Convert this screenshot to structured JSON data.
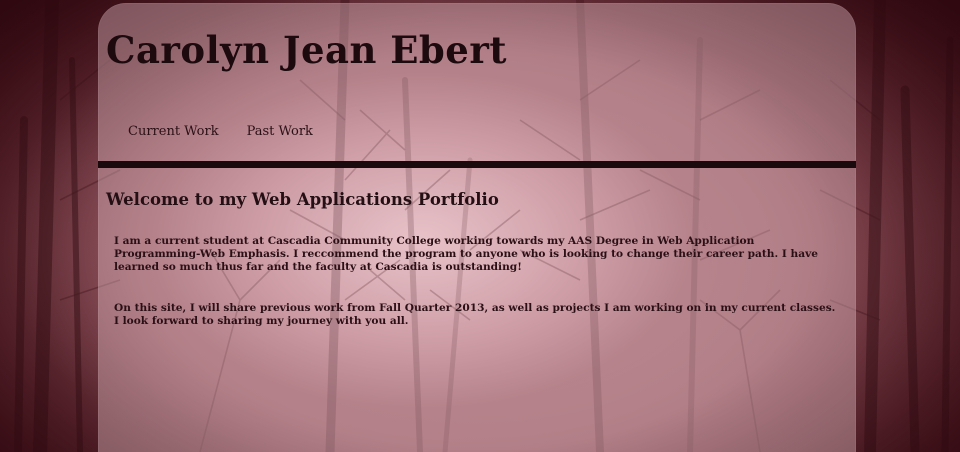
{
  "header": {
    "site_title": "Carolyn Jean Ebert"
  },
  "nav": {
    "items": [
      {
        "label": "Current Work"
      },
      {
        "label": "Past Work"
      }
    ]
  },
  "main": {
    "heading": "Welcome to my Web Applications Portfolio",
    "paragraphs": [
      "I am a current student at Cascadia Community College working towards my AAS Degree in Web Application Programming-Web Emphasis. I reccommend the program to anyone who is looking to change their career path. I have learned so much thus far and the faculty at Cascadia is outstanding!",
      "On this site, I will share previous work from Fall Quarter 2013, as well as projects I am working on in my current classes. I look forward to sharing my journey with you all."
    ]
  },
  "colors": {
    "page_background": "#3a1218",
    "panel_overlay": "#e1b9c0",
    "nav_rule": "#1b0a0d",
    "text": "#1d0a0e"
  }
}
